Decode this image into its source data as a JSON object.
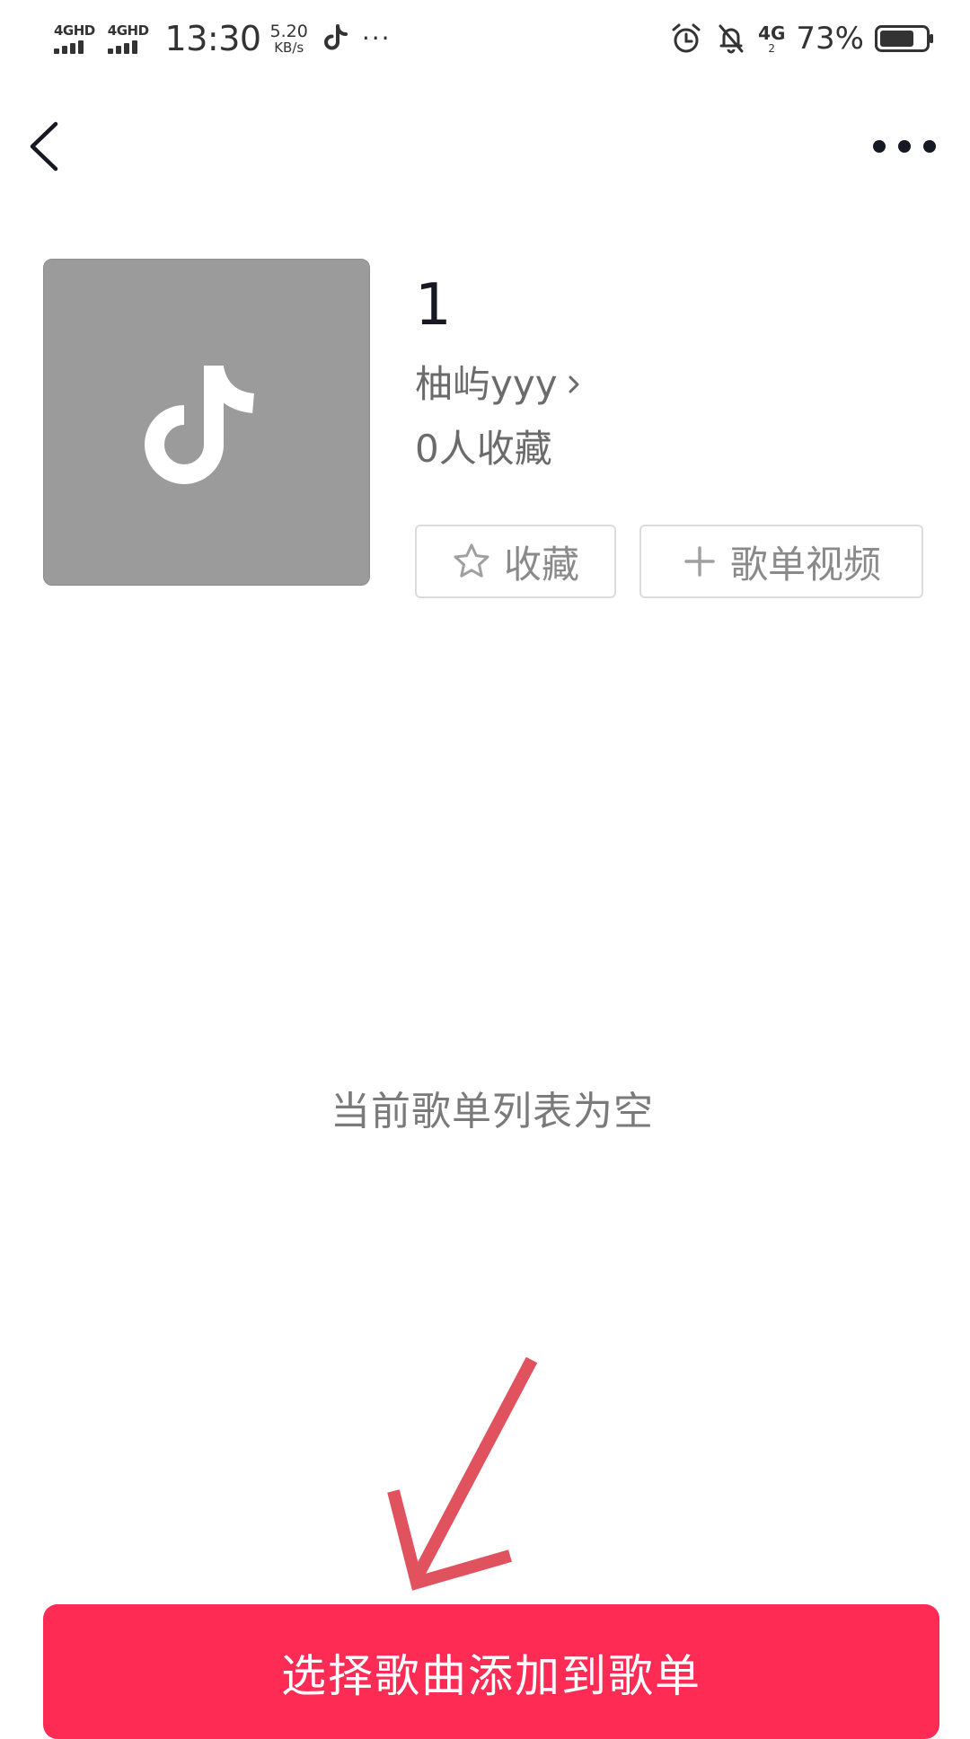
{
  "status_bar": {
    "signal1_label": "4GHD",
    "signal2_label": "4GHD",
    "time": "13:30",
    "speed_value": "5.20",
    "speed_unit": "KB/s",
    "notification_icons": [
      "tiktok-icon",
      "more-dots-icon"
    ],
    "more_dots": "···",
    "right_icons": [
      "alarm-icon",
      "bell-muted-icon"
    ],
    "network_top": "4G",
    "network_bottom": "2",
    "battery_percent": "73%",
    "battery_level": 0.73
  },
  "nav": {
    "back_icon": "chevron-left-icon",
    "more_icon": "more-horizontal-icon"
  },
  "playlist": {
    "cover_icon": "tiktok-note-icon",
    "cover_color": "#9b9b9b",
    "title": "1",
    "creator": "柚屿yyy",
    "favorites": "0人收藏",
    "favorite_button": "收藏",
    "video_button": "歌单视频"
  },
  "empty_state": {
    "message": "当前歌单列表为空"
  },
  "cta": {
    "label": "选择歌曲添加到歌单",
    "color": "#fe2c55"
  },
  "annotation": {
    "arrow_color": "#e0525e"
  }
}
